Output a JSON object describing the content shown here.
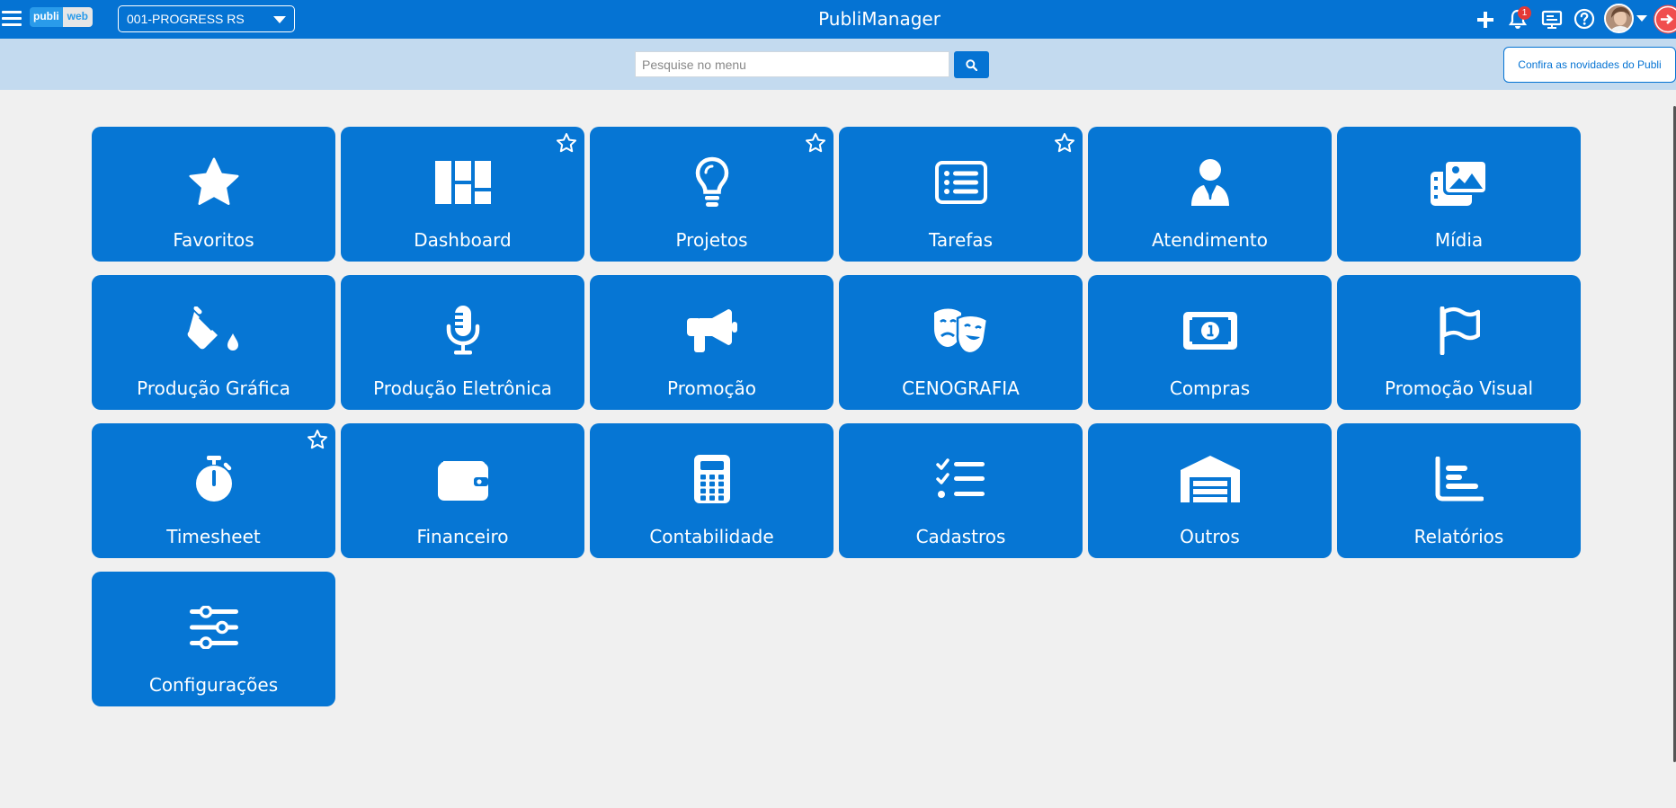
{
  "logo": {
    "part1": "publi",
    "part2": "web"
  },
  "company": {
    "selected": "001-PROGRESS RS"
  },
  "app_title": "PubliManager",
  "notifications": {
    "count": "1"
  },
  "search": {
    "placeholder": "Pesquise no menu",
    "value": ""
  },
  "news_button": "Confira as novidades do Publi",
  "top_icons": [
    "plus-icon",
    "bell-icon",
    "presentation-icon",
    "help-icon",
    "avatar",
    "chevron-down-icon",
    "logout-icon"
  ],
  "colors": {
    "primary": "#0573d3",
    "tile": "#0676d4",
    "searchbar": "#c3daef",
    "background": "#f0f0f0",
    "badge": "#e53935"
  },
  "tiles": [
    {
      "label": "Favoritos",
      "icon": "star-icon",
      "starred": false
    },
    {
      "label": "Dashboard",
      "icon": "dashboard-grid-icon",
      "starred": true
    },
    {
      "label": "Projetos",
      "icon": "lightbulb-icon",
      "starred": true
    },
    {
      "label": "Tarefas",
      "icon": "list-card-icon",
      "starred": true
    },
    {
      "label": "Atendimento",
      "icon": "user-tie-icon",
      "starred": false
    },
    {
      "label": "Mídia",
      "icon": "photo-film-icon",
      "starred": false
    },
    {
      "label": "Produção Gráfica",
      "icon": "paint-bucket-icon",
      "starred": false
    },
    {
      "label": "Produção Eletrônica",
      "icon": "microphone-icon",
      "starred": false
    },
    {
      "label": "Promoção",
      "icon": "megaphone-icon",
      "starred": false
    },
    {
      "label": "CENOGRAFIA",
      "icon": "theater-masks-icon",
      "starred": false
    },
    {
      "label": "Compras",
      "icon": "money-bill-icon",
      "starred": false
    },
    {
      "label": "Promoção Visual",
      "icon": "flag-icon",
      "starred": false
    },
    {
      "label": "Timesheet",
      "icon": "stopwatch-icon",
      "starred": true
    },
    {
      "label": "Financeiro",
      "icon": "wallet-icon",
      "starred": false
    },
    {
      "label": "Contabilidade",
      "icon": "calculator-icon",
      "starred": false
    },
    {
      "label": "Cadastros",
      "icon": "list-check-icon",
      "starred": false
    },
    {
      "label": "Outros",
      "icon": "warehouse-icon",
      "starred": false
    },
    {
      "label": "Relatórios",
      "icon": "bar-chart-icon",
      "starred": false
    },
    {
      "label": "Configurações",
      "icon": "sliders-icon",
      "starred": false
    }
  ]
}
